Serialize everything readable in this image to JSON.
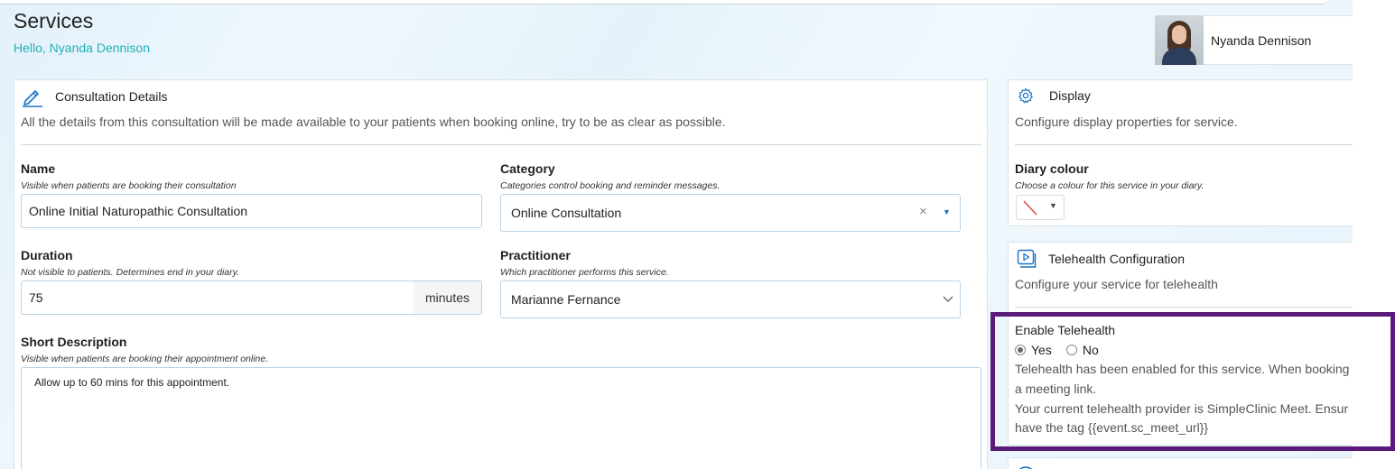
{
  "header": {
    "title": "Services",
    "greeting": "Hello, Nyanda Dennison",
    "user_name": "Nyanda Dennison"
  },
  "consultation": {
    "heading": "Consultation Details",
    "description": "All the details from this consultation will be made available to your patients when booking online, try to be as clear as possible.",
    "name": {
      "label": "Name",
      "hint": "Visible when patients are booking their consultation",
      "value": "Online Initial Naturopathic Consultation"
    },
    "category": {
      "label": "Category",
      "hint": "Categories control booking and reminder messages.",
      "value": "Online Consultation",
      "clear_glyph": "×",
      "caret_glyph": "▼"
    },
    "duration": {
      "label": "Duration",
      "hint": "Not visible to patients. Determines end in your diary.",
      "value": "75",
      "unit": "minutes"
    },
    "practitioner": {
      "label": "Practitioner",
      "hint": "Which practitioner performs this service.",
      "value": "Marianne Fernance"
    },
    "short_description": {
      "label": "Short Description",
      "hint": "Visible when patients are booking their appointment online.",
      "value": "Allow up to 60 mins for this appointment."
    }
  },
  "display": {
    "heading": "Display",
    "description": "Configure display properties for service.",
    "diary_colour": {
      "label": "Diary colour",
      "hint": "Choose a colour for this service in your diary.",
      "caret_glyph": "▼"
    }
  },
  "telehealth": {
    "heading": "Telehealth Configuration",
    "description": "Configure your service for telehealth",
    "enable_label": "Enable Telehealth",
    "yes_label": "Yes",
    "no_label": "No",
    "selected": "Yes",
    "line1": "Telehealth has been enabled for this service. When booking",
    "line2": "a meeting link.",
    "line3": "Your current telehealth provider is SimpleClinic Meet. Ensur",
    "line4": "have the tag {{event.sc_meet_url}}"
  },
  "colors": {
    "accent": "#21b0b8",
    "link_blue": "#1a73c6",
    "highlight": "#5a1a7a"
  }
}
